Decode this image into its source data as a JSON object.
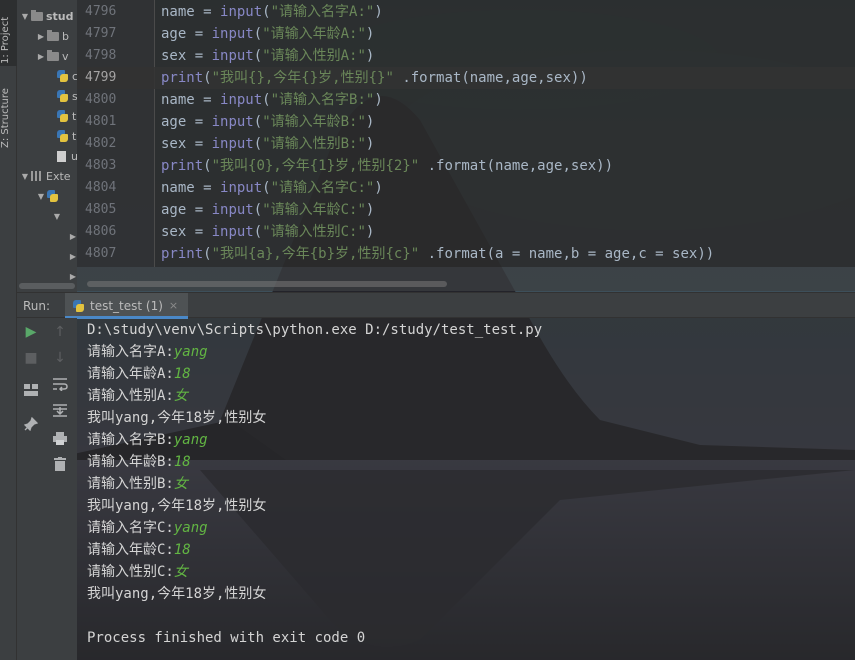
{
  "left_strip": {
    "project_tab": "1: Project",
    "structure_tab": "Z: Structure"
  },
  "project_tree": {
    "items": [
      {
        "label": "stud",
        "icon": "folder-icon"
      },
      {
        "label": "b",
        "icon": "folder-icon"
      },
      {
        "label": "v",
        "icon": "folder-icon"
      },
      {
        "label": "c",
        "icon": "python-file-icon"
      },
      {
        "label": "s",
        "icon": "python-file-icon"
      },
      {
        "label": "t",
        "icon": "python-file-icon"
      },
      {
        "label": "t",
        "icon": "python-file-icon"
      },
      {
        "label": "u",
        "icon": "text-file-icon"
      },
      {
        "label": "Exte",
        "icon": "libraries-icon"
      }
    ]
  },
  "editor": {
    "lines": [
      {
        "num": "4796",
        "var": "name",
        "fn": "input",
        "arg": "\"请输入名字A:\""
      },
      {
        "num": "4797",
        "var": "age",
        "fn": "input",
        "arg": "\"请输入年龄A:\""
      },
      {
        "num": "4798",
        "var": "sex",
        "fn": "input",
        "arg": "\"请输入性别A:\""
      },
      {
        "num": "4799",
        "fn": "print",
        "arg": "\"我叫{},今年{}岁,性别{}\"",
        "rest": " .format(name,age,sex))"
      },
      {
        "num": "4800",
        "var": "name",
        "fn": "input",
        "arg": "\"请输入名字B:\""
      },
      {
        "num": "4801",
        "var": "age",
        "fn": "input",
        "arg": "\"请输入年龄B:\""
      },
      {
        "num": "4802",
        "var": "sex",
        "fn": "input",
        "arg": "\"请输入性别B:\""
      },
      {
        "num": "4803",
        "fn": "print",
        "arg": "\"我叫{0},今年{1}岁,性别{2}\"",
        "rest": " .format(name,age,sex))"
      },
      {
        "num": "4804",
        "var": "name",
        "fn": "input",
        "arg": "\"请输入名字C:\""
      },
      {
        "num": "4805",
        "var": "age",
        "fn": "input",
        "arg": "\"请输入年龄C:\""
      },
      {
        "num": "4806",
        "var": "sex",
        "fn": "input",
        "arg": "\"请输入性别C:\""
      },
      {
        "num": "4807",
        "fn": "print",
        "arg": "\"我叫{a},今年{b}岁,性别{c}\"",
        "rest": " .format(a = name,b = age,c = sex))"
      }
    ],
    "current_line": "4799"
  },
  "run": {
    "label": "Run:",
    "tab_title": "test_test (1)",
    "tab_close": "×"
  },
  "console": {
    "command": "D:\\study\\venv\\Scripts\\python.exe D:/study/test_test.py",
    "lines": [
      {
        "prompt": "请输入名字A:",
        "input": "yang"
      },
      {
        "prompt": "请输入年龄A:",
        "input": "18"
      },
      {
        "prompt": "请输入性别A:",
        "input": "女"
      },
      {
        "prompt": "我叫yang,今年18岁,性别女",
        "input": ""
      },
      {
        "prompt": "请输入名字B:",
        "input": "yang"
      },
      {
        "prompt": "请输入年龄B:",
        "input": "18"
      },
      {
        "prompt": "请输入性别B:",
        "input": "女"
      },
      {
        "prompt": "我叫yang,今年18岁,性别女",
        "input": ""
      },
      {
        "prompt": "请输入名字C:",
        "input": "yang"
      },
      {
        "prompt": "请输入年龄C:",
        "input": "18"
      },
      {
        "prompt": "请输入性别C:",
        "input": "女"
      },
      {
        "prompt": "我叫yang,今年18岁,性别女",
        "input": ""
      }
    ],
    "exit_message": "Process finished with exit code 0"
  },
  "colors": {
    "keyword_fn": "#8888c6",
    "string": "#6a8759",
    "param": "#aa4926",
    "input_echo": "#62b543",
    "tab_accent": "#4a88c7"
  }
}
